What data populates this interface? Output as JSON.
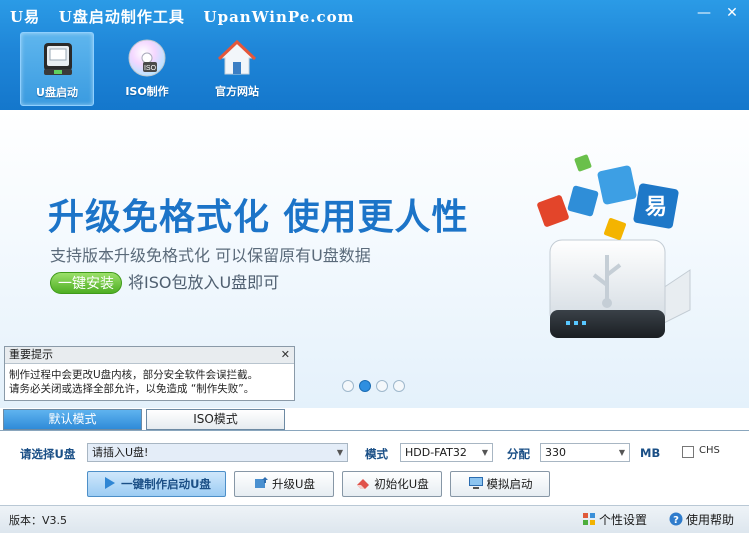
{
  "window": {
    "title": "U易   U盘启动制作工具   UpanWinPe.com",
    "minimize": "—",
    "close": "✕"
  },
  "nav": [
    {
      "label": "U盘启动",
      "icon": "usb-drive-icon",
      "active": true
    },
    {
      "label": "ISO制作",
      "icon": "disc-icon",
      "active": false
    },
    {
      "label": "官方网站",
      "icon": "home-icon",
      "active": false
    }
  ],
  "banner": {
    "headline": "升级免格式化 使用更人性",
    "subline": "支持版本升级免格式化 可以保留原有U盘数据",
    "oneclick": "一键安装",
    "tail": "将ISO包放入U盘即可",
    "slides": 4,
    "active_slide": 1
  },
  "notice": {
    "title": "重要提示",
    "close": "✕",
    "line1": "制作过程中会更改U盘内核，部分安全软件会误拦截。",
    "line2": "请务必关闭或选择全部允许，以免造成 “制作失败”。"
  },
  "tabs": {
    "default_mode": "默认模式",
    "iso_mode": "ISO模式"
  },
  "form": {
    "disk_label": "请选择U盘",
    "disk_value": "请插入U盘!",
    "mode_label": "模式",
    "mode_value": "HDD-FAT32",
    "alloc_label": "分配",
    "alloc_value": "330",
    "unit": "MB",
    "chs_label": "CHS"
  },
  "buttons": {
    "make": "一键制作启动U盘",
    "upgrade": "升级U盘",
    "init": "初始化U盘",
    "simulate": "模拟启动"
  },
  "status": {
    "version": "版本：V3.5",
    "personal": "个性设置",
    "help": "使用帮助"
  },
  "colors": {
    "title_blue": "#1f86d8",
    "headline_blue": "#1c74c8",
    "accent_green": "#4eae23"
  }
}
